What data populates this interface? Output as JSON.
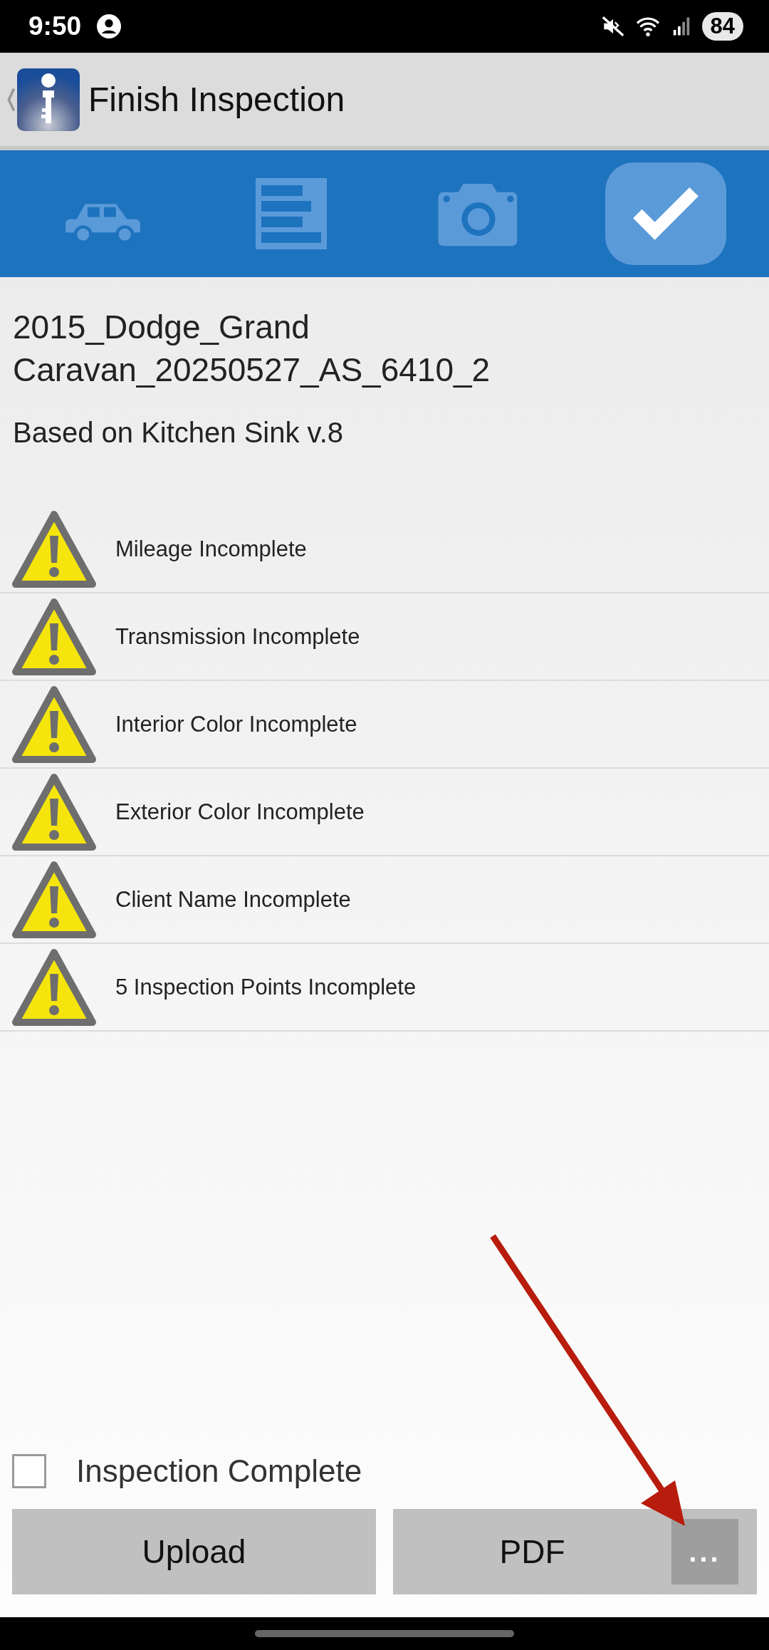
{
  "status_bar": {
    "time": "9:50",
    "battery": "84"
  },
  "header": {
    "title": "Finish Inspection"
  },
  "tabs": [
    {
      "kind": "car",
      "selected": false
    },
    {
      "kind": "form",
      "selected": false
    },
    {
      "kind": "camera",
      "selected": false
    },
    {
      "kind": "check",
      "selected": true
    }
  ],
  "inspection": {
    "name": "2015_Dodge_Grand Caravan_20250527_AS_6410_2",
    "template": "Based on Kitchen Sink v.8"
  },
  "warnings": [
    {
      "text": "Mileage Incomplete"
    },
    {
      "text": "Transmission Incomplete"
    },
    {
      "text": "Interior Color Incomplete"
    },
    {
      "text": "Exterior Color Incomplete"
    },
    {
      "text": "Client Name Incomplete"
    },
    {
      "text": "5 Inspection Points Incomplete"
    }
  ],
  "complete_checkbox": {
    "label": "Inspection Complete",
    "checked": false
  },
  "buttons": {
    "upload": "Upload",
    "pdf": "PDF",
    "more": "..."
  }
}
